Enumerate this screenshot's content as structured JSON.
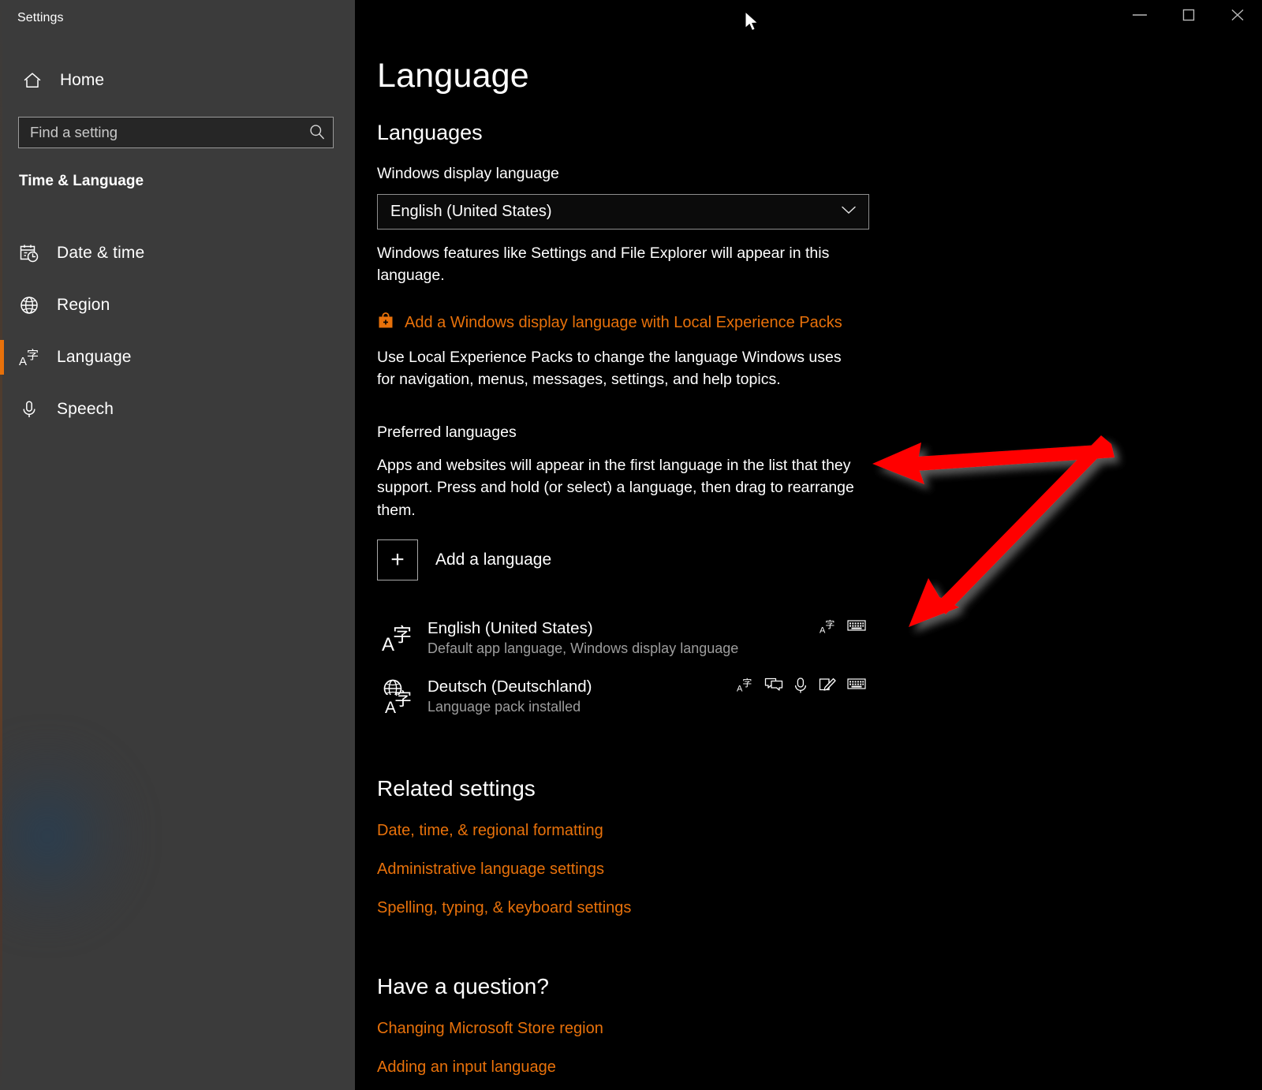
{
  "window": {
    "title": "Settings",
    "controls": {
      "minimize": "Minimize",
      "maximize": "Maximize",
      "close": "Close"
    }
  },
  "sidebar": {
    "home_label": "Home",
    "search": {
      "placeholder": "Find a setting",
      "value": "",
      "icon": "search-icon"
    },
    "group_label": "Time & Language",
    "items": [
      {
        "label": "Date & time",
        "icon": "calendar-clock-icon",
        "active": false
      },
      {
        "label": "Region",
        "icon": "globe-icon",
        "active": false
      },
      {
        "label": "Language",
        "icon": "translate-icon",
        "active": true
      },
      {
        "label": "Speech",
        "icon": "microphone-icon",
        "active": false
      }
    ]
  },
  "main": {
    "page_title": "Language",
    "languages_section": {
      "heading": "Languages",
      "display_language_label": "Windows display language",
      "display_language_value": "English (United States)",
      "display_language_note": "Windows features like Settings and File Explorer will appear in this language.",
      "lep_link": "Add a Windows display language with Local Experience Packs",
      "lep_icon": "microsoft-store-bag-icon",
      "lep_note": "Use Local Experience Packs to change the language Windows uses for navigation, menus, messages, settings, and help topics."
    },
    "preferred": {
      "heading": "Preferred languages",
      "description": "Apps and websites will appear in the first language in the list that they support. Press and hold (or select) a language, then drag to rearrange them.",
      "add_button_label": "Add a language",
      "add_button_icon": "plus-icon",
      "languages": [
        {
          "name": "English (United States)",
          "status": "Default app language, Windows display language",
          "icon": "translate-a-ji-icon",
          "actions": [
            "translate-icon",
            "keyboard-icon"
          ]
        },
        {
          "name": "Deutsch (Deutschland)",
          "status": "Language pack installed",
          "icon": "globe-translate-icon",
          "actions": [
            "translate-icon",
            "speech-icon",
            "microphone-icon",
            "handwriting-icon",
            "keyboard-icon"
          ]
        }
      ]
    },
    "related_settings": {
      "heading": "Related settings",
      "links": [
        "Date, time, & regional formatting",
        "Administrative language settings",
        "Spelling, typing, & keyboard settings"
      ]
    },
    "have_a_question": {
      "heading": "Have a question?",
      "links": [
        "Changing Microsoft Store region",
        "Adding an input language"
      ]
    }
  },
  "annotation": {
    "type": "double-headed-bent-arrow",
    "color": "#FF0000",
    "points_to": [
      "preferred-languages-description",
      "deutsch-language-row"
    ]
  },
  "colors": {
    "accent": "#E8710A",
    "sidebar_bg": "#3B3B3B",
    "content_bg": "#000000",
    "secondary_text": "#9D9D9D"
  }
}
